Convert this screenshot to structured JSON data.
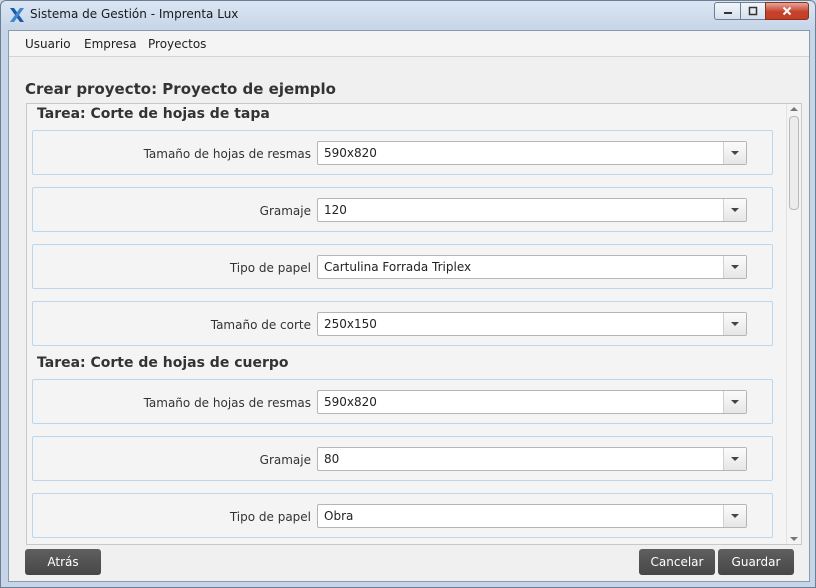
{
  "window": {
    "title": "Sistema de Gestión - Imprenta Lux",
    "icon": "app-x-icon"
  },
  "menu": {
    "items": [
      "Usuario",
      "Empresa",
      "Proyectos"
    ]
  },
  "page": {
    "title": "Crear proyecto: Proyecto de ejemplo"
  },
  "tasks": [
    {
      "title": "Tarea: Corte de hojas de tapa",
      "fields": [
        {
          "label": "Tamaño de hojas de resmas",
          "value": "590x820"
        },
        {
          "label": "Gramaje",
          "value": "120"
        },
        {
          "label": "Tipo de papel",
          "value": "Cartulina Forrada Triplex"
        },
        {
          "label": "Tamaño de corte",
          "value": "250x150"
        }
      ]
    },
    {
      "title": "Tarea: Corte de hojas de cuerpo",
      "fields": [
        {
          "label": "Tamaño de hojas de resmas",
          "value": "590x820"
        },
        {
          "label": "Gramaje",
          "value": "80"
        },
        {
          "label": "Tipo de papel",
          "value": "Obra"
        }
      ]
    }
  ],
  "buttons": {
    "back": "Atrás",
    "cancel": "Cancelar",
    "save": "Guardar"
  },
  "colors": {
    "button": "#4f4f4f",
    "field_border": "#bcd6ee",
    "app_icon": "#1c5aa5"
  }
}
